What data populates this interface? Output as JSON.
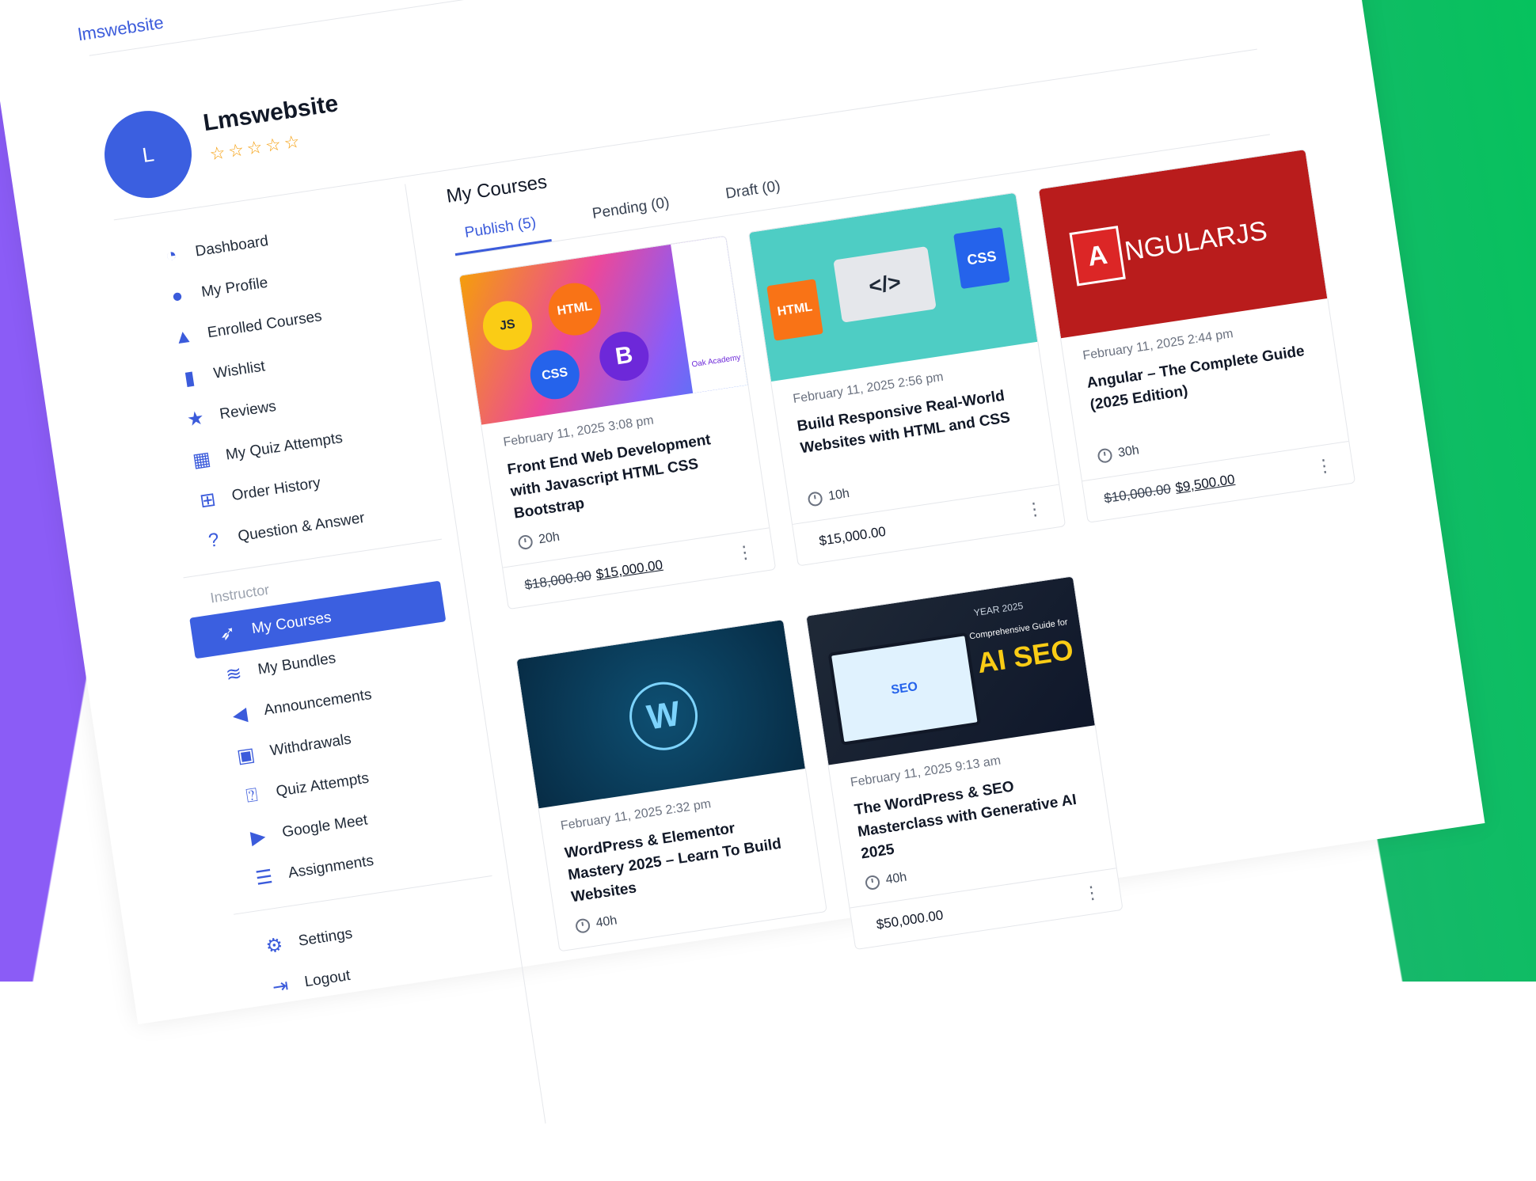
{
  "top_link": "lmswebsite",
  "profile": {
    "initial": "L",
    "name": "Lmswebsite",
    "stars": "☆☆☆☆☆"
  },
  "sidebar": {
    "items": [
      {
        "label": "Dashboard",
        "icon": "dashboard-icon"
      },
      {
        "label": "My Profile",
        "icon": "user-icon"
      },
      {
        "label": "Enrolled Courses",
        "icon": "graduation-cap-icon"
      },
      {
        "label": "Wishlist",
        "icon": "bookmark-icon"
      },
      {
        "label": "Reviews",
        "icon": "star-icon"
      },
      {
        "label": "My Quiz Attempts",
        "icon": "quiz-icon"
      },
      {
        "label": "Order History",
        "icon": "cart-icon"
      },
      {
        "label": "Question & Answer",
        "icon": "question-icon"
      }
    ],
    "section_label": "Instructor",
    "instructor_items": [
      {
        "label": "My Courses",
        "icon": "rocket-icon"
      },
      {
        "label": "My Bundles",
        "icon": "layers-icon"
      },
      {
        "label": "Announcements",
        "icon": "megaphone-icon"
      },
      {
        "label": "Withdrawals",
        "icon": "wallet-icon"
      },
      {
        "label": "Quiz Attempts",
        "icon": "question-square-icon"
      },
      {
        "label": "Google Meet",
        "icon": "video-icon"
      },
      {
        "label": "Assignments",
        "icon": "checklist-icon"
      }
    ],
    "bottom_items": [
      {
        "label": "Settings",
        "icon": "gear-icon"
      },
      {
        "label": "Logout",
        "icon": "logout-icon"
      }
    ]
  },
  "main": {
    "title": "My Courses",
    "tabs": [
      "Publish (5)",
      "Pending (0)",
      "Draft (0)"
    ]
  },
  "courses": [
    {
      "date": "February 11, 2025 3:08 pm",
      "title": "Front End Web Development with Javascript HTML CSS Bootstrap",
      "duration": "20h",
      "old_price": "$18,000.00",
      "price": "$15,000.00",
      "thumb_labels": [
        "JS",
        "HTML",
        "CSS",
        "B",
        "Oak Academy"
      ]
    },
    {
      "date": "February 11, 2025 2:56 pm",
      "title": "Build Responsive Real-World Websites with HTML and CSS",
      "duration": "10h",
      "old_price": "",
      "price": "$15,000.00",
      "thumb_labels": [
        "HTML",
        "</>",
        "CSS"
      ]
    },
    {
      "date": "February 11, 2025 2:44 pm",
      "title": "Angular – The Complete Guide (2025 Edition)",
      "duration": "30h",
      "old_price": "$10,000.00",
      "price": "$9,500.00",
      "thumb_labels": [
        "A",
        "NGULARJS"
      ]
    },
    {
      "date": "February 11, 2025 2:32 pm",
      "title": "WordPress & Elementor Mastery 2025 – Learn To Build Websites",
      "duration": "40h",
      "old_price": "",
      "price": "",
      "thumb_labels": [
        "W"
      ]
    },
    {
      "date": "February 11, 2025 9:13 am",
      "title": "The WordPress & SEO Masterclass with Generative AI 2025",
      "duration": "40h",
      "old_price": "",
      "price": "$50,000.00",
      "thumb_labels": [
        "YEAR 2025",
        "Comprehensive Guide for",
        "AI SEO",
        "SEO"
      ]
    }
  ]
}
